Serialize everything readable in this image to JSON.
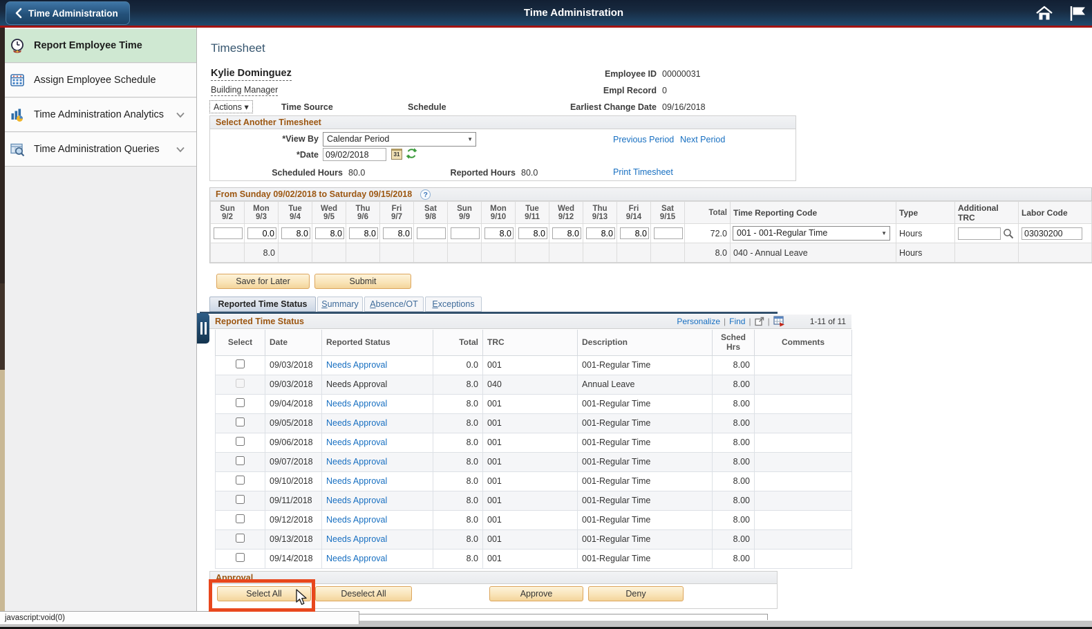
{
  "header": {
    "back_label": "Time Administration",
    "title": "Time Administration"
  },
  "sidebar": {
    "items": [
      {
        "label": "Report Employee Time",
        "icon": "clock-icon",
        "active": true
      },
      {
        "label": "Assign Employee Schedule",
        "icon": "calendar-icon",
        "active": false
      },
      {
        "label": "Time Administration Analytics",
        "icon": "bar-chart-icon",
        "active": false,
        "chevron": true
      },
      {
        "label": "Time Administration Queries",
        "icon": "query-grid-icon",
        "active": false,
        "chevron": true
      }
    ]
  },
  "page": {
    "title": "Timesheet",
    "name": "Kylie Dominguez",
    "role": "Building Manager",
    "actions_label": "Actions",
    "time_source_label": "Time Source",
    "schedule_label": "Schedule",
    "info": [
      {
        "label": "Employee ID",
        "value": "00000031"
      },
      {
        "label": "Empl Record",
        "value": "0"
      },
      {
        "label": "Earliest Change Date",
        "value": "09/16/2018"
      }
    ]
  },
  "select_panel": {
    "title": "Select Another Timesheet",
    "view_by_label": "*View By",
    "view_by_value": "Calendar Period",
    "prev": "Previous Period",
    "next": "Next Period",
    "date_label": "*Date",
    "date_value": "09/02/2018",
    "sched_label": "Scheduled Hours",
    "sched_value": "80.0",
    "rep_label": "Reported Hours",
    "rep_value": "80.0",
    "print": "Print Timesheet"
  },
  "grid": {
    "title": "From Sunday 09/02/2018 to Saturday 09/15/2018",
    "days": [
      {
        "day": "Sun",
        "date": "9/2"
      },
      {
        "day": "Mon",
        "date": "9/3"
      },
      {
        "day": "Tue",
        "date": "9/4"
      },
      {
        "day": "Wed",
        "date": "9/5"
      },
      {
        "day": "Thu",
        "date": "9/6"
      },
      {
        "day": "Fri",
        "date": "9/7"
      },
      {
        "day": "Sat",
        "date": "9/8"
      },
      {
        "day": "Sun",
        "date": "9/9"
      },
      {
        "day": "Mon",
        "date": "9/10"
      },
      {
        "day": "Tue",
        "date": "9/11"
      },
      {
        "day": "Wed",
        "date": "9/12"
      },
      {
        "day": "Thu",
        "date": "9/13"
      },
      {
        "day": "Fri",
        "date": "9/14"
      },
      {
        "day": "Sat",
        "date": "9/15"
      }
    ],
    "headers": {
      "total": "Total",
      "trc": "Time Reporting Code",
      "type": "Type",
      "addtrc": "Additional TRC",
      "labor": "Labor Code"
    },
    "rows": [
      {
        "values": [
          "",
          "0.0",
          "8.0",
          "8.0",
          "8.0",
          "8.0",
          "",
          "",
          "8.0",
          "8.0",
          "8.0",
          "8.0",
          "8.0",
          ""
        ],
        "total": "72.0",
        "trc": "001 - 001-Regular Time",
        "type": "Hours",
        "labor": "03030200"
      },
      {
        "values": [
          "",
          "8.0",
          "",
          "",
          "",
          "",
          "",
          "",
          "",
          "",
          "",
          "",
          "",
          ""
        ],
        "total": "8.0",
        "trc": "040 - Annual Leave",
        "type": "Hours",
        "labor": ""
      }
    ]
  },
  "buttons": {
    "save": "Save for Later",
    "submit": "Submit"
  },
  "tabs": {
    "active": {
      "label": "Reported Time Status"
    },
    "others": [
      {
        "first": "S",
        "rest": "ummary"
      },
      {
        "first": "A",
        "rest": "bsence/OT"
      },
      {
        "first": "E",
        "rest": "xceptions"
      }
    ]
  },
  "status_table": {
    "title": "Reported Time Status",
    "personalize": "Personalize",
    "find": "Find",
    "count": "1-11 of 11",
    "columns": [
      "Select",
      "Date",
      "Reported Status",
      "Total",
      "TRC",
      "Description",
      "Sched Hrs",
      "Comments"
    ],
    "rows": [
      {
        "date": "09/03/2018",
        "status": "Needs Approval",
        "total": "0.0",
        "trc": "001",
        "desc": "001-Regular Time",
        "sched": "8.00",
        "link": true
      },
      {
        "date": "09/03/2018",
        "status": "Needs Approval",
        "total": "8.0",
        "trc": "040",
        "desc": "Annual Leave",
        "sched": "8.00",
        "link": false
      },
      {
        "date": "09/04/2018",
        "status": "Needs Approval",
        "total": "8.0",
        "trc": "001",
        "desc": "001-Regular Time",
        "sched": "8.00",
        "link": true
      },
      {
        "date": "09/05/2018",
        "status": "Needs Approval",
        "total": "8.0",
        "trc": "001",
        "desc": "001-Regular Time",
        "sched": "8.00",
        "link": true
      },
      {
        "date": "09/06/2018",
        "status": "Needs Approval",
        "total": "8.0",
        "trc": "001",
        "desc": "001-Regular Time",
        "sched": "8.00",
        "link": true
      },
      {
        "date": "09/07/2018",
        "status": "Needs Approval",
        "total": "8.0",
        "trc": "001",
        "desc": "001-Regular Time",
        "sched": "8.00",
        "link": true
      },
      {
        "date": "09/10/2018",
        "status": "Needs Approval",
        "total": "8.0",
        "trc": "001",
        "desc": "001-Regular Time",
        "sched": "8.00",
        "link": true
      },
      {
        "date": "09/11/2018",
        "status": "Needs Approval",
        "total": "8.0",
        "trc": "001",
        "desc": "001-Regular Time",
        "sched": "8.00",
        "link": true
      },
      {
        "date": "09/12/2018",
        "status": "Needs Approval",
        "total": "8.0",
        "trc": "001",
        "desc": "001-Regular Time",
        "sched": "8.00",
        "link": true
      },
      {
        "date": "09/13/2018",
        "status": "Needs Approval",
        "total": "8.0",
        "trc": "001",
        "desc": "001-Regular Time",
        "sched": "8.00",
        "link": true
      },
      {
        "date": "09/14/2018",
        "status": "Needs Approval",
        "total": "8.0",
        "trc": "001",
        "desc": "001-Regular Time",
        "sched": "8.00",
        "link": true
      }
    ]
  },
  "approval": {
    "title": "Approval",
    "select_all": "Select All",
    "deselect_all": "Deselect All",
    "approve": "Approve",
    "deny": "Deny"
  },
  "statusbar": {
    "text": "javascript:void(0)"
  },
  "icons": {
    "actions_arrow": "▾",
    "select_arrow": "▼",
    "help": "?",
    "calendar_day": "31",
    "sep": "|"
  },
  "colors": {
    "header_navy": "#17293f",
    "red_line": "#a31313",
    "active_item_green": "#cfe8d2",
    "section_title_orange": "#9c5712",
    "link_blue": "#176fc1",
    "button_cream": "#f9e3b6",
    "annotation_red_box": "#e8471d"
  }
}
